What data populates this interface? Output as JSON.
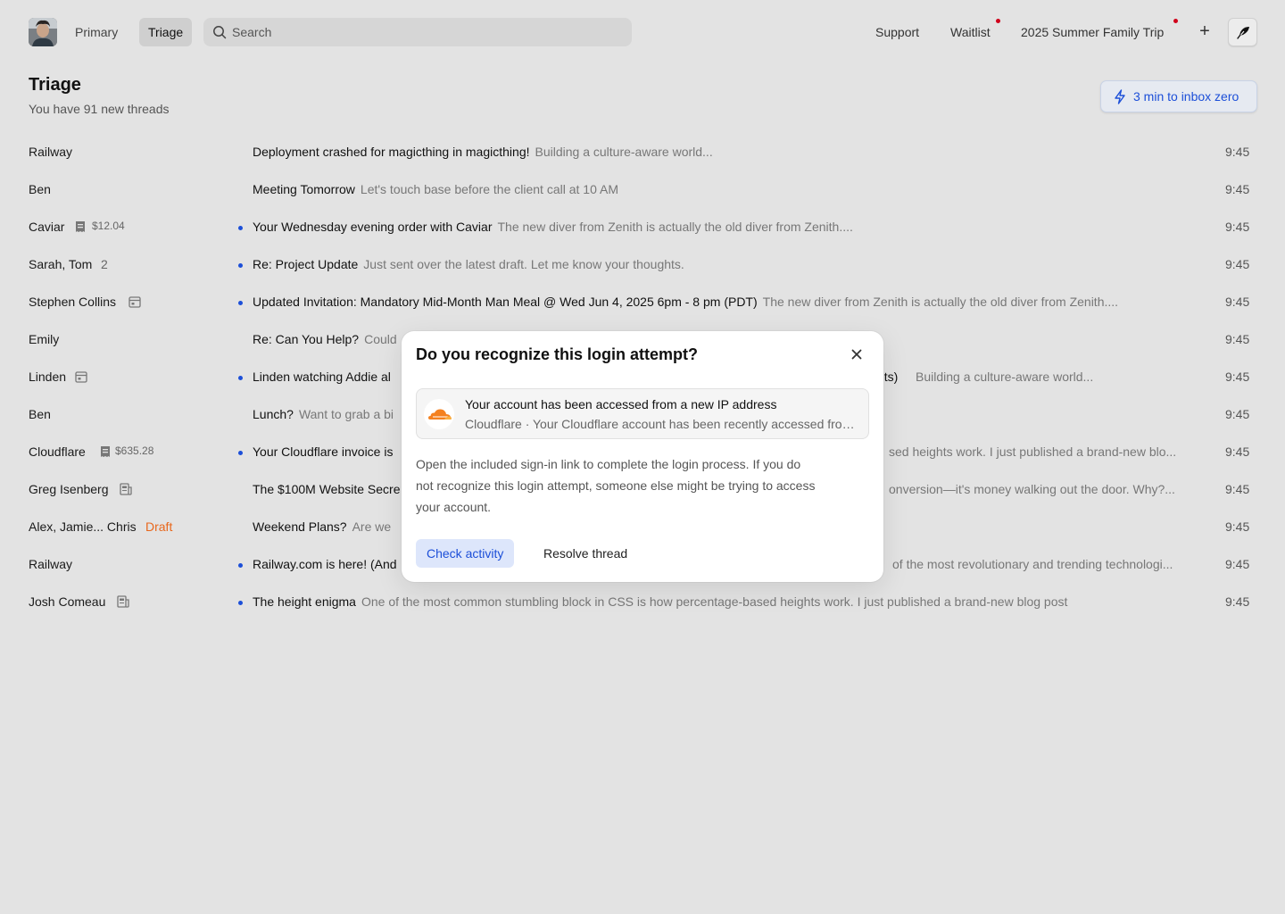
{
  "topbar": {
    "tabs": [
      {
        "label": "Primary"
      },
      {
        "label": "Triage",
        "active": true
      }
    ],
    "search": {
      "placeholder": "Search"
    },
    "nav": [
      {
        "label": "Support",
        "notification": false
      },
      {
        "label": "Waitlist",
        "notification": true
      },
      {
        "label": "2025 Summer Family Trip",
        "notification": true
      }
    ],
    "plus_label": "+",
    "icons": {
      "search": "search-icon",
      "compose": "feather-compose-icon",
      "avatar": "user-avatar"
    }
  },
  "header": {
    "title": "Triage",
    "subtitle": "You have 91 new threads",
    "inbox_zero": "3 min to inbox zero"
  },
  "threads": [
    {
      "sender": "Railway",
      "unread": false,
      "subject": "Deployment crashed for magicthing in magicthing!",
      "snippet": "Building a culture-aware world...",
      "time": "9:45"
    },
    {
      "sender": "Ben",
      "unread": false,
      "subject": "Meeting Tomorrow",
      "snippet": "Let's touch base before the client call at 10 AM",
      "time": "9:45"
    },
    {
      "sender": "Caviar",
      "meta": "$12.04",
      "icon": "receipt-icon",
      "unread": true,
      "subject": "Your Wednesday evening order with Caviar",
      "snippet": "The new diver from Zenith is actually the old diver from Zenith....",
      "time": "9:45"
    },
    {
      "sender": "Sarah, Tom",
      "count": "2",
      "unread": true,
      "subject": "Re: Project Update",
      "snippet": "Just sent over the latest draft. Let me know your thoughts.",
      "time": "9:45"
    },
    {
      "sender": "Stephen Collins",
      "icon": "calendar-icon",
      "unread": true,
      "subject": "Updated Invitation: Mandatory Mid-Month Man Meal @ Wed Jun 4, 2025 6pm - 8 pm (PDT)",
      "snippet": "The new diver from Zenith is actually the old diver from Zenith....",
      "time": "9:45"
    },
    {
      "sender": "Emily",
      "unread": false,
      "subject": "Re: Can You Help?",
      "snippet": "Could",
      "time": "9:45"
    },
    {
      "sender": "Linden",
      "icon": "calendar-icon",
      "unread": true,
      "subject": "Linden watching Addie al",
      "subject_tail": "nts)",
      "snippet": "Building a culture-aware world...",
      "time": "9:45"
    },
    {
      "sender": "Ben",
      "unread": false,
      "subject": "Lunch?",
      "snippet": "Want to grab a bi",
      "time": "9:45"
    },
    {
      "sender": "Cloudflare",
      "meta": "$635.28",
      "icon": "receipt-icon",
      "unread": true,
      "subject": "Your Cloudflare invoice is",
      "snippet": "sed heights work. I just published a brand-new blo...",
      "time": "9:45"
    },
    {
      "sender": "Greg Isenberg",
      "icon": "newsletter-icon",
      "unread": false,
      "subject": "The $100M Website Secre",
      "snippet": "onversion—it's money walking out the door. Why?...",
      "time": "9:45"
    },
    {
      "sender": "Alex, Jamie... Chris",
      "draft": "Draft",
      "unread": false,
      "subject": "Weekend Plans?",
      "snippet": "Are we",
      "time": "9:45"
    },
    {
      "sender": "Railway",
      "unread": true,
      "subject": "Railway.com is here! (And",
      "snippet": "of the most revolutionary and trending technologi...",
      "time": "9:45"
    },
    {
      "sender": "Josh Comeau",
      "icon": "newsletter-icon",
      "unread": true,
      "subject": "The height enigma",
      "snippet": "One of the most common stumbling block in CSS is how percentage-based heights work. I just published a brand-new blog post",
      "time": "9:45"
    }
  ],
  "modal": {
    "title": "Do you recognize this login attempt?",
    "card": {
      "title": "Your account has been accessed from a new IP address",
      "subtitle": "Cloudflare · Your Cloudflare account has been recently accessed from a new IP address",
      "logo": "cloudflare-logo-icon"
    },
    "body": "Open the included sign-in link to complete the login process. If you do not recognize this login attempt, someone else might be trying to access your account.",
    "primary_button": "Check activity",
    "secondary_button": "Resolve thread"
  },
  "colors": {
    "background": "#e3e3e3",
    "accent": "#1c4fd8",
    "unread_dot": "#1c4fd8",
    "notification_dot": "#d0021b",
    "draft": "#e8671c",
    "cloudflare_orange": "#f48120"
  }
}
